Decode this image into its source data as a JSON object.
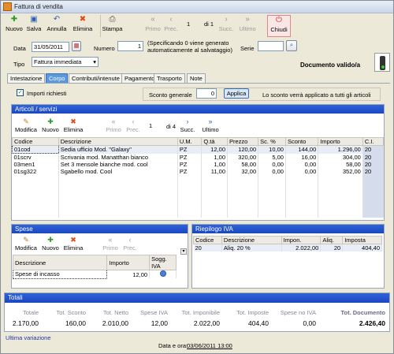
{
  "window": {
    "title": "Fattura di vendita"
  },
  "toolbar": {
    "nuovo": "Nuovo",
    "salva": "Salva",
    "annulla": "Annulla",
    "elimina": "Elimina",
    "stampa": "Stampa",
    "primo": "Primo",
    "prec": "Prec.",
    "page": "1",
    "of": "di 1",
    "succ": "Succ.",
    "ultimo": "Ultimo",
    "chiudi": "Chiudi"
  },
  "header": {
    "data_label": "Data",
    "data_value": "31/05/2011",
    "numero_label": "Numero",
    "numero_value": "1",
    "numero_hint": "(Specificando 0 viene generato automaticamente al salvataggio)",
    "serie_label": "Serie",
    "serie_value": "",
    "tipo_label": "Tipo",
    "tipo_value": "Fattura immediata",
    "doc_status": "Documento valido/a"
  },
  "tabs": [
    "Intestazione",
    "Corpo",
    "Contributi/intenute",
    "Pagamento",
    "Trasporto",
    "Note"
  ],
  "options": {
    "importi_richiesti": "Importi richiesti",
    "sconto_generale_label": "Sconto generale",
    "sconto_generale_value": "0",
    "applica": "Applica",
    "sconto_hint": "Lo sconto verrà applicato a tutti gli articoli"
  },
  "articoli": {
    "title": "Articoli / servizi",
    "toolbar": {
      "modifica": "Modifica",
      "nuovo": "Nuovo",
      "elimina": "Elimina",
      "primo": "Primo",
      "prec": "Prec.",
      "page": "1",
      "of": "di 4",
      "succ": "Succ.",
      "ultimo": "Ultimo"
    },
    "columns": [
      "Codice",
      "Descrizione",
      "U.M.",
      "Q.tà",
      "Prezzo",
      "Sc. %",
      "Sconto",
      "Importo",
      "C.I."
    ],
    "rows": [
      [
        "01cod",
        "Sedia ufficio Mod. \"Galaxy\"",
        "PZ",
        "12,00",
        "120,00",
        "10,00",
        "144,00",
        "1.296,00",
        "20"
      ],
      [
        "01scrv",
        "Scrivania mod. Manatthan bianco",
        "PZ",
        "1,00",
        "320,00",
        "5,00",
        "16,00",
        "304,00",
        "20"
      ],
      [
        "03men1",
        "Set 3 mensole bianche mod. cool",
        "PZ",
        "1,00",
        "58,00",
        "0,00",
        "0,00",
        "58,00",
        "20"
      ],
      [
        "01sg322",
        "Sgabello mod. Cool",
        "PZ",
        "11,00",
        "32,00",
        "0,00",
        "0,00",
        "352,00",
        "20"
      ]
    ]
  },
  "spese": {
    "title": "Spese",
    "toolbar": {
      "modifica": "Modifica",
      "nuovo": "Nuovo",
      "elimina": "Elimina",
      "primo": "Primo",
      "prec": "Prec."
    },
    "columns": [
      "Descrizione",
      "Importo",
      "Sogg. IVA"
    ],
    "rows": [
      [
        "Spese di incasso",
        "12,00",
        ""
      ]
    ]
  },
  "iva": {
    "title": "Riepilogo IVA",
    "columns": [
      "Codice",
      "Descrizione",
      "Impon.",
      "Aliq.",
      "Imposta"
    ],
    "rows": [
      [
        "20",
        "Aliq. 20 %",
        "2.022,00",
        "20",
        "404,40"
      ]
    ]
  },
  "totali": {
    "title": "Totali",
    "labels": [
      "Totale",
      "Tot. Sconto",
      "Tot. Netto",
      "Spese IVA",
      "Tot. Imponibile",
      "Tot. Imposte",
      "Spese no IVA",
      "Tot. Documento"
    ],
    "values": [
      "2.170,00",
      "160,00",
      "2.010,00",
      "12,00",
      "2.022,00",
      "404,40",
      "0,00",
      "2.426,40"
    ]
  },
  "footer": {
    "ultima_variazione": "Ultima variazione",
    "data_ora_label": "Data e ora:",
    "data_ora_value": "03/06/2011 13:00"
  }
}
